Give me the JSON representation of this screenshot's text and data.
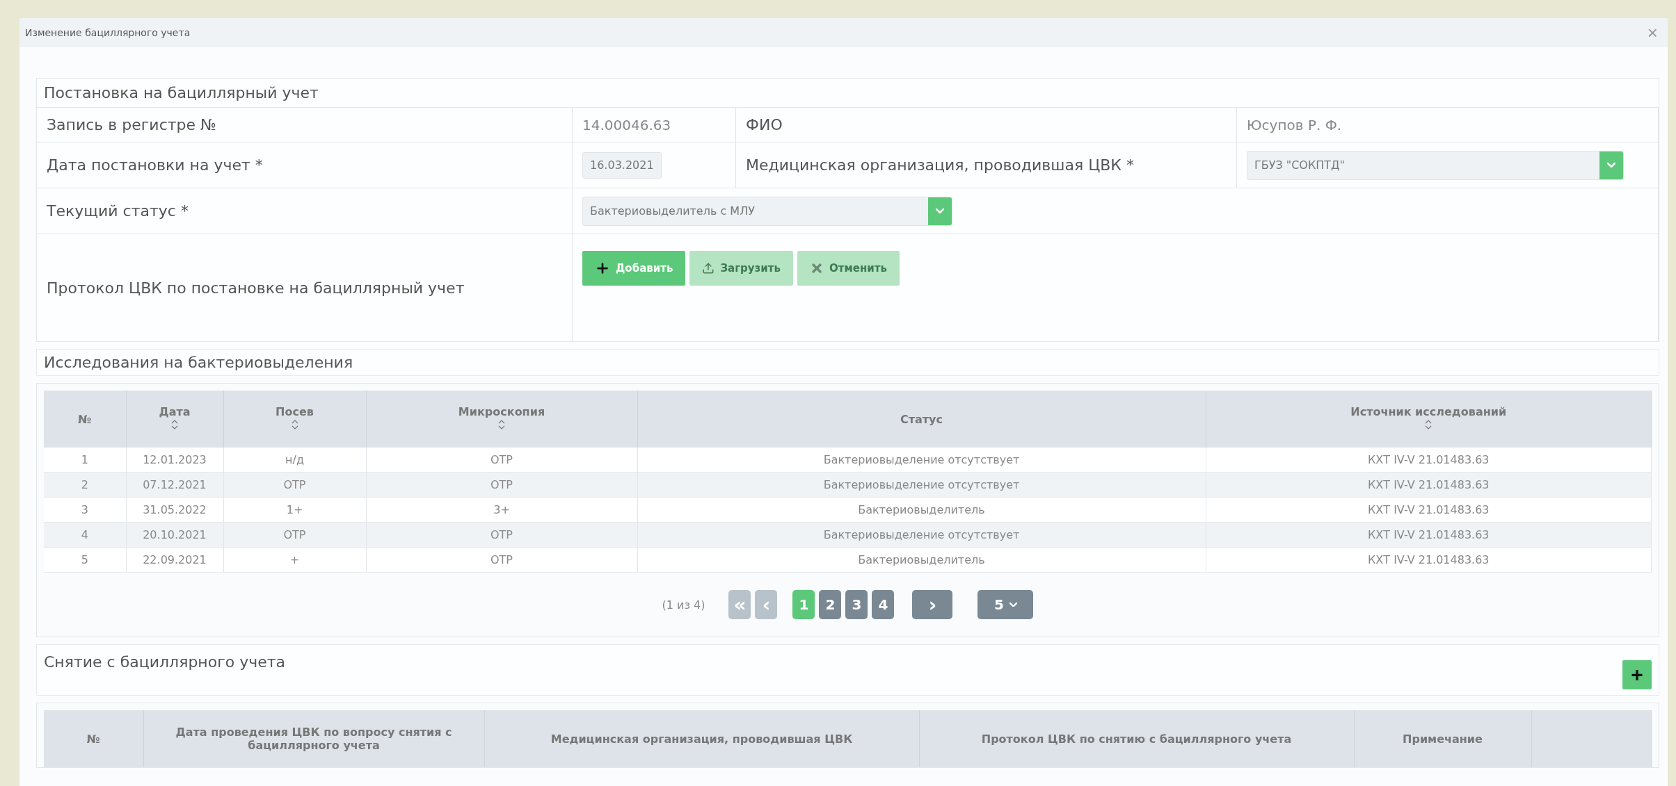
{
  "window": {
    "title": "Изменение бациллярного учета",
    "close": "×"
  },
  "registration": {
    "title": "Постановка на бациллярный учет",
    "record_label": "Запись в регистре №",
    "record_value": "14.00046.63",
    "fio_label": "ФИО",
    "fio_value": "Юсупов Р. Ф.",
    "date_label": "Дата постановки на учет *",
    "date_value": "16.03.2021",
    "org_label": "Медицинская организация, проводившая ЦВК *",
    "org_value": "ГБУЗ \"СОКПТД\"",
    "status_label": "Текущий статус *",
    "status_value": "Бактериовыделитель с МЛУ",
    "protocol_label": "Протокол ЦВК по постановке на бациллярный учет",
    "buttons": [
      {
        "kind": "add",
        "label": "Добавить",
        "disabled": false
      },
      {
        "kind": "upload",
        "label": "Загрузить",
        "disabled": true
      },
      {
        "kind": "cancel",
        "label": "Отменить",
        "disabled": true
      }
    ]
  },
  "studies": {
    "title": "Исследования на бактериовыделения",
    "columns": [
      {
        "label": "№",
        "sortable": false
      },
      {
        "label": "Дата",
        "sortable": true
      },
      {
        "label": "Посев",
        "sortable": true
      },
      {
        "label": "Микроскопия",
        "sortable": true
      },
      {
        "label": "Статус",
        "sortable": false
      },
      {
        "label": "Источник исследований",
        "sortable": true
      }
    ],
    "rows": [
      [
        "1",
        "12.01.2023",
        "н/д",
        "ОТР",
        "Бактериовыделение отсутствует",
        "КХТ IV-V 21.01483.63"
      ],
      [
        "2",
        "07.12.2021",
        "ОТР",
        "ОТР",
        "Бактериовыделение отсутствует",
        "КХТ IV-V 21.01483.63"
      ],
      [
        "3",
        "31.05.2022",
        "1+",
        "3+",
        "Бактериовыделитель",
        "КХТ IV-V 21.01483.63"
      ],
      [
        "4",
        "20.10.2021",
        "ОТР",
        "ОТР",
        "Бактериовыделение отсутствует",
        "КХТ IV-V 21.01483.63"
      ],
      [
        "5",
        "22.09.2021",
        "+",
        "ОТР",
        "Бактериовыделитель",
        "КХТ IV-V 21.01483.63"
      ]
    ],
    "pager": {
      "summary": "(1 из 4)",
      "first": {
        "label": "«",
        "disabled": true
      },
      "prev": {
        "label": "‹",
        "disabled": true
      },
      "pages": [
        {
          "label": "1",
          "selected": true
        },
        {
          "label": "2",
          "selected": false
        },
        {
          "label": "3",
          "selected": false
        },
        {
          "label": "4",
          "selected": false
        }
      ],
      "next": {
        "label": "›",
        "disabled": false
      },
      "page_size": "5"
    }
  },
  "removal": {
    "title": "Снятие с бациллярного учета",
    "add": "+",
    "columns": [
      "№",
      "Дата проведения ЦВК по вопросу снятия с бациллярного учета",
      "Медицинская организация, проводившая ЦВК",
      "Протокол ЦВК по снятию с бациллярного учета",
      "Примечание"
    ]
  }
}
